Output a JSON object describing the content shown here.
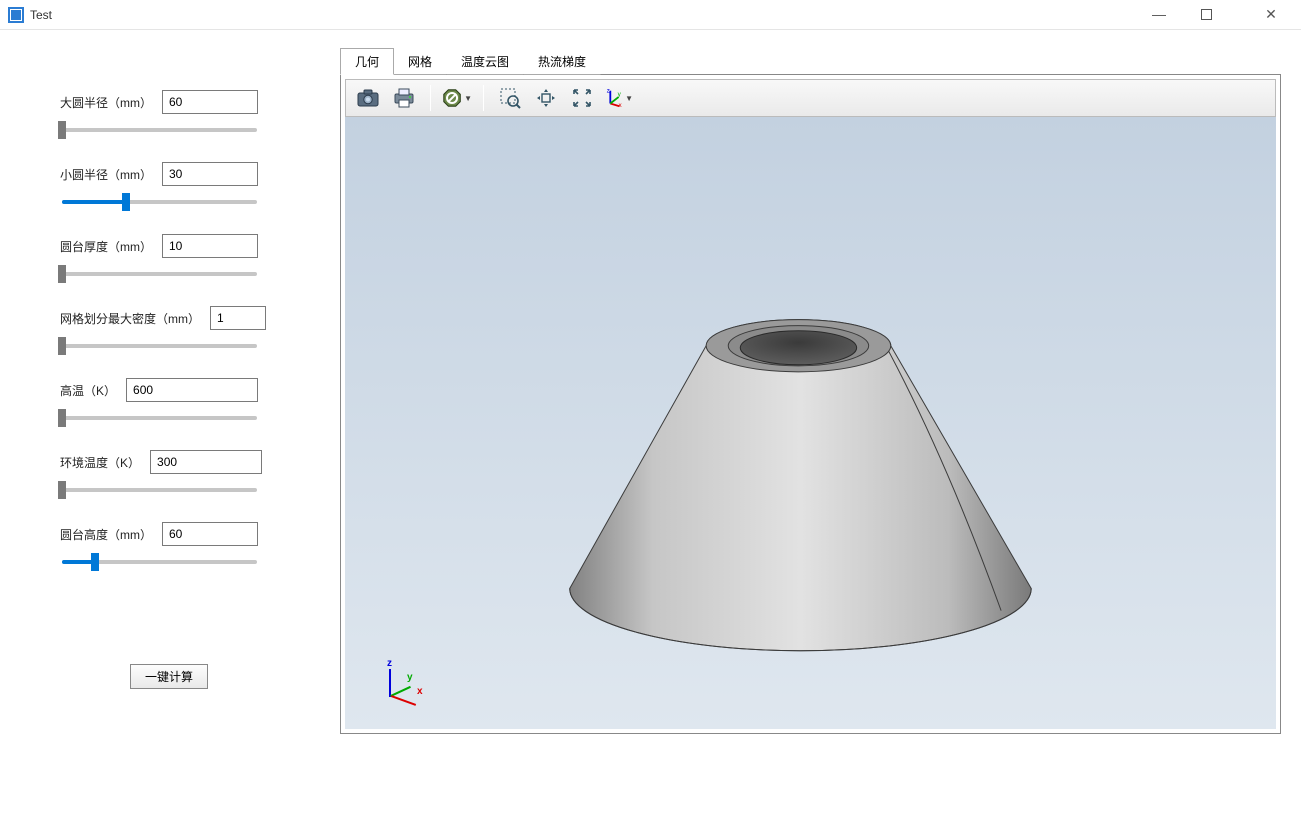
{
  "window": {
    "title": "Test"
  },
  "params": [
    {
      "label": "大圆半径（mm）",
      "value": "60",
      "slider_percent": 0
    },
    {
      "label": "小圆半径（mm）",
      "value": "30",
      "slider_percent": 33
    },
    {
      "label": "圆台厚度（mm）",
      "value": "10",
      "slider_percent": 0
    },
    {
      "label": "网格划分最大密度（mm）",
      "value": "1",
      "slider_percent": 0
    },
    {
      "label": "高温（K）",
      "value": "600",
      "slider_percent": 0
    },
    {
      "label": "环境温度（K）",
      "value": "300",
      "slider_percent": 0
    },
    {
      "label": "圆台高度（mm）",
      "value": "60",
      "slider_percent": 17
    }
  ],
  "calc_button_label": "一键计算",
  "tabs": [
    {
      "label": "几何",
      "active": true
    },
    {
      "label": "网格",
      "active": false
    },
    {
      "label": "温度云图",
      "active": false
    },
    {
      "label": "热流梯度",
      "active": false
    }
  ],
  "toolbar_icons": [
    "camera-icon",
    "printer-icon",
    "sep",
    "stop-sign-icon",
    "sep",
    "zoom-window-icon",
    "pan-icon",
    "zoom-extents-icon",
    "axis-icon"
  ],
  "axis_labels": {
    "x": "x",
    "y": "y",
    "z": "z"
  }
}
